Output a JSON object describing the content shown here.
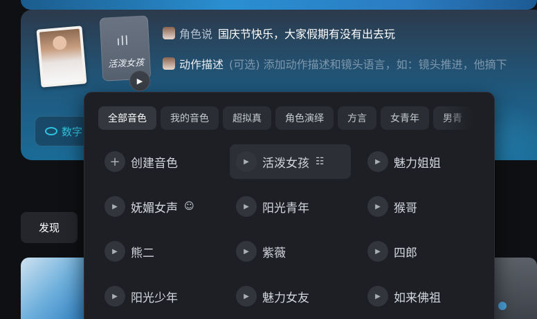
{
  "composer": {
    "voice_file_name": "活泼女孩",
    "voice_wave_glyph": "ıll",
    "play_glyph": "▶",
    "line1": {
      "label": "角色说",
      "text": "国庆节快乐，大家假期有没有出去玩"
    },
    "line2": {
      "label": "动作描述",
      "placeholder": "(可选) 添加动作描述和镜头语言，如：镜头推进，他摘下"
    },
    "digital_button": "数字"
  },
  "nav": {
    "discover": "发现"
  },
  "voice_picker": {
    "tabs": [
      "全部音色",
      "我的音色",
      "超拟真",
      "角色演绎",
      "方言",
      "女青年",
      "男青"
    ],
    "active_tab": 0,
    "play_glyph": "▶",
    "plus_glyph": "+",
    "settings_glyph": "☷",
    "clone_glyph": "☺",
    "items": [
      {
        "label": "创建音色",
        "icon": "plus-icon"
      },
      {
        "label": "活泼女孩",
        "icon": "play-icon",
        "selected": true,
        "extra": "settings-icon"
      },
      {
        "label": "魅力姐姐",
        "icon": "play-icon"
      },
      {
        "label": "妩媚女声",
        "icon": "play-icon",
        "extra": "clone-icon"
      },
      {
        "label": "阳光青年",
        "icon": "play-icon"
      },
      {
        "label": "猴哥",
        "icon": "play-icon"
      },
      {
        "label": "熊二",
        "icon": "play-icon"
      },
      {
        "label": "紫薇",
        "icon": "play-icon"
      },
      {
        "label": "四郎",
        "icon": "play-icon"
      },
      {
        "label": "阳光少年",
        "icon": "play-icon"
      },
      {
        "label": "魅力女友",
        "icon": "play-icon"
      },
      {
        "label": "如来佛祖",
        "icon": "play-icon"
      }
    ]
  },
  "colors": {
    "accent": "#2fc4e0",
    "popover_bg": "#1d1f24",
    "tab_bg": "#2a2d33"
  }
}
